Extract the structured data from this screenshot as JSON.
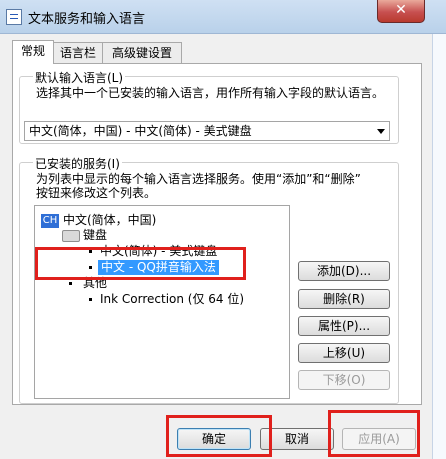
{
  "window": {
    "title": "文本服务和输入语言",
    "close_glyph": "✕"
  },
  "tabs": [
    {
      "label": "常规",
      "active": true
    },
    {
      "label": "语言栏",
      "active": false
    },
    {
      "label": "高级键设置",
      "active": false
    }
  ],
  "default_lang": {
    "group_label": "默认输入语言(L)",
    "description": "选择其中一个已安装的输入语言，用作所有输入字段的默认语言。",
    "selected": "中文(简体，中国) - 中文(简体) - 美式键盘"
  },
  "installed": {
    "group_label": "已安装的服务(I)",
    "description_line1": "为列表中显示的每个输入语言选择服务。使用“添加”和“删除”",
    "description_line2": "按钮来修改这个列表。",
    "tree": {
      "lang_icon": "CH",
      "lang": "中文(简体，中国)",
      "keyboard": "键盘",
      "kbd_item1": "中文(简体) - 美式键盘",
      "kbd_item2": "中文 - QQ拼音输入法",
      "other": "其他",
      "other_item1": "Ink Correction (仅 64 位)"
    },
    "buttons": {
      "add": "添加(D)...",
      "remove": "删除(R)",
      "properties": "属性(P)...",
      "move_up": "上移(U)",
      "move_down": "下移(O)"
    }
  },
  "footer": {
    "ok": "确定",
    "cancel": "取消",
    "apply": "应用(A)"
  },
  "icons": [
    "app-icon",
    "close-icon",
    "language-ch-icon",
    "keyboard-icon",
    "chevron-down-icon"
  ],
  "colors": {
    "selection": "#3399ff",
    "highlight_box": "#e0201c",
    "titlebar": "#cfe0f3"
  }
}
